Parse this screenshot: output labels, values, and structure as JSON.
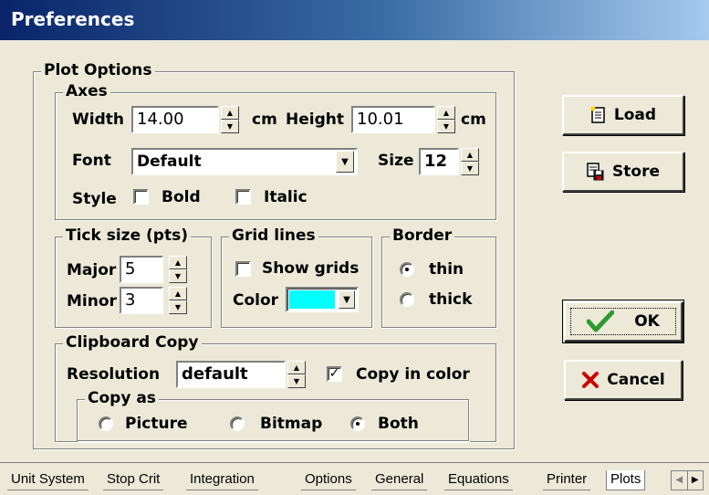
{
  "window": {
    "title": "Preferences"
  },
  "plot_options": {
    "group_label": "Plot Options",
    "axes": {
      "group_label": "Axes",
      "width_label": "Width",
      "width_value": "14.00",
      "width_unit": "cm",
      "height_label": "Height",
      "height_value": "10.01",
      "height_unit": "cm",
      "font_label": "Font",
      "font_value": "Default",
      "size_label": "Size",
      "size_value": "12",
      "style_label": "Style",
      "bold_label": "Bold",
      "bold_checked": false,
      "italic_label": "Italic",
      "italic_checked": false
    },
    "tick_size": {
      "group_label": "Tick size (pts)",
      "major_label": "Major",
      "major_value": "5",
      "minor_label": "Minor",
      "minor_value": "3"
    },
    "grid_lines": {
      "group_label": "Grid lines",
      "show_grids_label": "Show grids",
      "show_grids_checked": false,
      "color_label": "Color",
      "color_value": "#00ffff"
    },
    "border": {
      "group_label": "Border",
      "options": [
        "thin",
        "thick"
      ],
      "selected": "thin"
    },
    "clipboard": {
      "group_label": "Clipboard Copy",
      "resolution_label": "Resolution",
      "resolution_value": "default",
      "copy_in_color_label": "Copy in color",
      "copy_in_color_checked": true,
      "copy_as": {
        "group_label": "Copy as",
        "options": [
          "Picture",
          "Bitmap",
          "Both"
        ],
        "selected": "Both"
      }
    }
  },
  "buttons": {
    "load_label": "Load",
    "store_label": "Store",
    "ok_label": "OK",
    "cancel_label": "Cancel"
  },
  "tabs": [
    "Unit System",
    "Stop Crit",
    "Integration",
    "Options",
    "General",
    "Equations",
    "Printer",
    "Plots"
  ],
  "active_tab": "Plots",
  "colors": {
    "ok_check": "#2e9a2e",
    "cancel_x": "#cc0000",
    "title_start": "#0a246a",
    "title_end": "#a6caf0"
  }
}
